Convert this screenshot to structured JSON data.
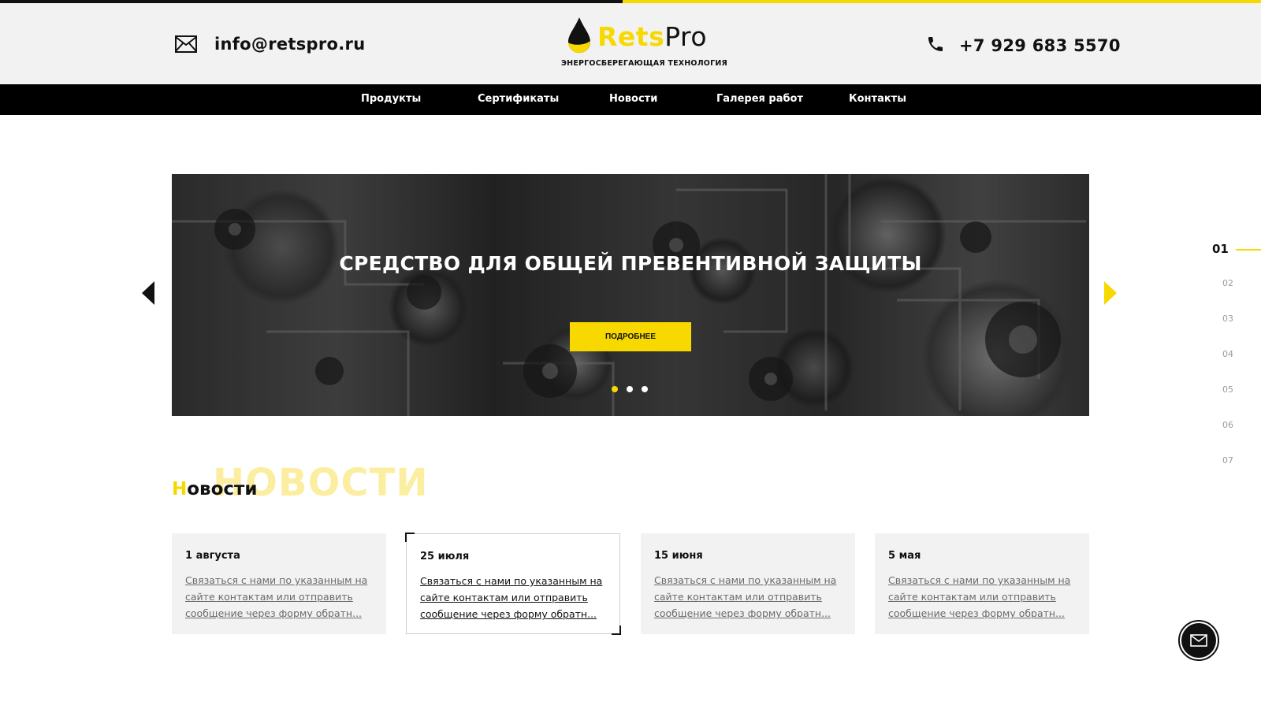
{
  "header": {
    "email": "info@retspro.ru",
    "phone": "+7 929 683 5570",
    "logo": {
      "part1": "Rets",
      "part2": "Pro",
      "tagline": "ЭНЕРГОСБЕРЕГАЮЩАЯ ТЕХНОЛОГИЯ"
    }
  },
  "nav": {
    "items": [
      "Продукты",
      "Сертификаты",
      "Новости",
      "Галерея работ",
      "Контакты"
    ]
  },
  "slider": {
    "title": "СРЕДСТВО ДЛЯ ОБЩЕЙ ПРЕВЕНТИВНОЙ ЗАЩИТЫ",
    "button": "ПОДРОБНЕЕ",
    "active_dot": 1,
    "dot_count": 3
  },
  "side_index": {
    "items": [
      "01",
      "02",
      "03",
      "04",
      "05",
      "06",
      "07"
    ],
    "active": "01"
  },
  "news": {
    "ghost": "НОВОСТИ",
    "title_first": "Н",
    "title_rest": "овости",
    "cards": [
      {
        "date": "1 августа",
        "text": "Связаться с нами по указанным на сайте контактам или отправить сообщение через форму обратн..."
      },
      {
        "date": "25 июля",
        "text": "Связаться с нами по указанным на сайте контактам или отправить сообщение через форму обратн..."
      },
      {
        "date": "15 июня",
        "text": "Связаться с нами по указанным на сайте контактам или отправить сообщение через форму обратн..."
      },
      {
        "date": "5 мая",
        "text": "Связаться с нами по указанным на сайте контактам или отправить сообщение через форму обратн..."
      }
    ],
    "active_card": 1
  },
  "colors": {
    "accent": "#f7d900",
    "dark": "#111111",
    "header_bg": "#f2f2f3"
  },
  "icons": [
    "envelope-icon",
    "phone-icon",
    "arrow-left-icon",
    "arrow-right-icon",
    "logo-drop-icon",
    "mail-fab-icon"
  ]
}
